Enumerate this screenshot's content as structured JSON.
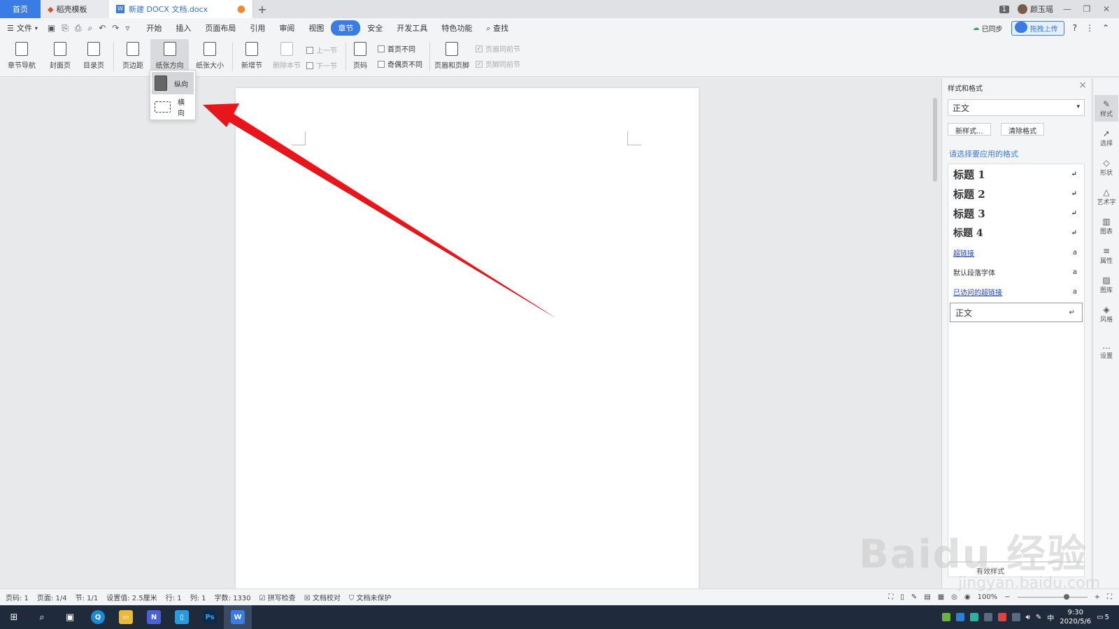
{
  "tabs": {
    "home": "首页",
    "template": "稻壳模板",
    "doc": "新建 DOCX 文档.docx"
  },
  "title_right": {
    "badge": "1",
    "user": "颜玉瑶"
  },
  "menu": {
    "file": "文件",
    "items": [
      "开始",
      "插入",
      "页面布局",
      "引用",
      "审阅",
      "视图",
      "章节",
      "安全",
      "开发工具",
      "特色功能"
    ],
    "active_index": 6,
    "search": "查找",
    "sync": "已同步",
    "upload": "拖拽上传"
  },
  "ribbon": {
    "section_nav": "章节导航",
    "cover": "封面页",
    "toc": "目录页",
    "margin": "页边距",
    "orientation": "纸张方向",
    "size": "纸张大小",
    "new_section": "新增节",
    "delete_section": "删除本节",
    "prev_section": "上一节",
    "next_section": "下一节",
    "page_num": "页码",
    "first_page_diff": "首页不同",
    "odd_even_diff": "奇偶页不同",
    "header_footer": "页眉和页脚",
    "header_same_prev": "页眉同前节",
    "footer_same_prev": "页脚同前节"
  },
  "orientation_menu": {
    "portrait": "纵向",
    "landscape": "横向",
    "selected": "纵向"
  },
  "styles_panel": {
    "title": "样式和格式",
    "current_style": "正文",
    "new_style": "新样式...",
    "clear_format": "清除格式",
    "hint": "请选择要应用的格式",
    "items": [
      {
        "label": "标题 1",
        "mark": "↵"
      },
      {
        "label": "标题 2",
        "mark": "↵"
      },
      {
        "label": "标题 3",
        "mark": "↵"
      },
      {
        "label": "标题 4",
        "mark": "↵"
      },
      {
        "label": "超链接",
        "mark": "a"
      },
      {
        "label": "默认段落字体",
        "mark": "a"
      },
      {
        "label": "已访问的超链接",
        "mark": "a"
      },
      {
        "label": "正文",
        "mark": "↵"
      }
    ],
    "footer": "有效样式"
  },
  "sidebar": [
    "样式",
    "选择",
    "形状",
    "艺术字",
    "图表",
    "属性",
    "图库",
    "风格",
    "设置"
  ],
  "status": {
    "page_code": "页码: 1",
    "page": "页面: 1/4",
    "section": "节: 1/1",
    "setting": "设置值: 2.5厘米",
    "row": "行: 1",
    "col": "列: 1",
    "words": "字数: 1330",
    "spell": "拼写检查",
    "proof": "文档校对",
    "protect": "文档未保护",
    "zoom": "100%"
  },
  "taskbar": {
    "apps": [
      "Q",
      "▭",
      "N",
      "▯",
      "Ps",
      "W"
    ],
    "time": "9:30",
    "date": "2020/5/6",
    "ime": "中",
    "notify": "5"
  },
  "watermark": {
    "main": "Baidu 经验",
    "sub": "jingyan.baidu.com"
  },
  "colors": {
    "accent": "#3b7be6",
    "arrow": "#e8161b"
  }
}
